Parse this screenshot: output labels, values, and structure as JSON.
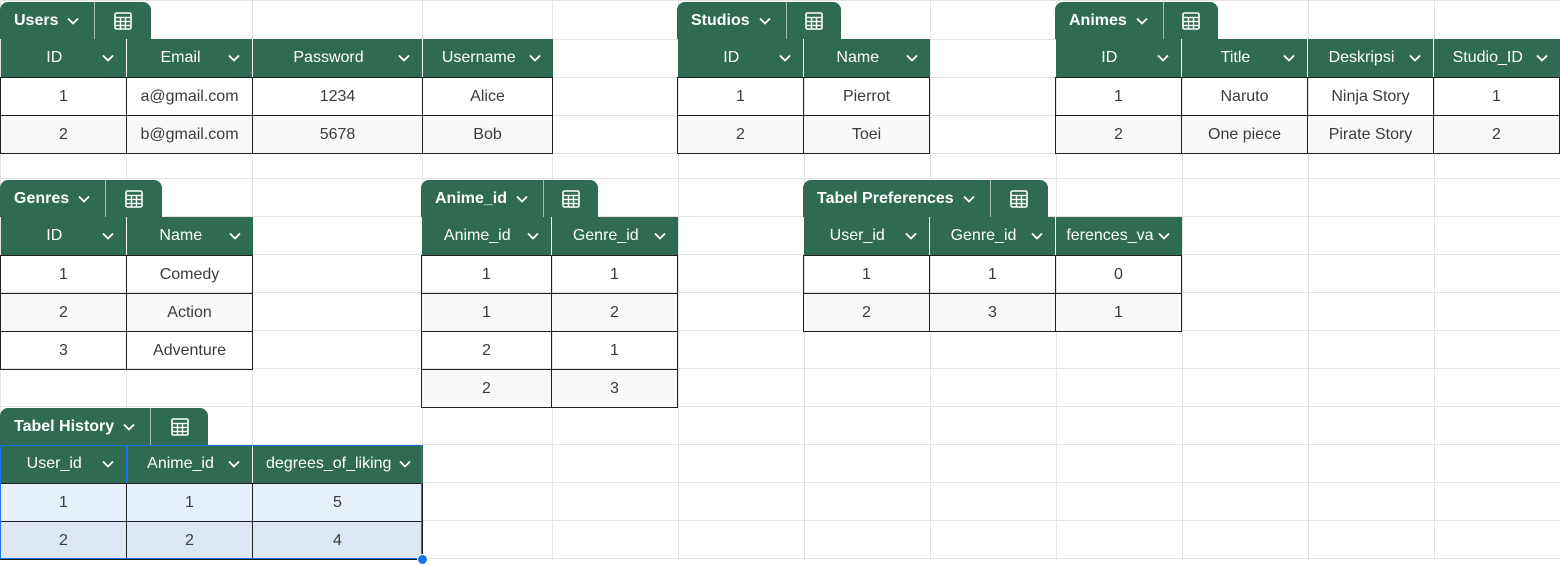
{
  "icons": {
    "dropdown": "chevron-down-icon",
    "table": "table-icon"
  },
  "colors": {
    "header": "#2f6b52",
    "selection": "#1a73e8",
    "text": "#3c3c3c"
  },
  "tables": [
    {
      "key": "users",
      "name": "Users",
      "columns": [
        "ID",
        "Email",
        "Password",
        "Username"
      ],
      "rows": [
        [
          "1",
          "a@gmail.com",
          "1234",
          "Alice"
        ],
        [
          "2",
          "b@gmail.com",
          "5678",
          "Bob"
        ]
      ]
    },
    {
      "key": "studios",
      "name": "Studios",
      "columns": [
        "ID",
        "Name"
      ],
      "rows": [
        [
          "1",
          "Pierrot"
        ],
        [
          "2",
          "Toei"
        ]
      ]
    },
    {
      "key": "animes",
      "name": "Animes",
      "columns": [
        "ID",
        "Title",
        "Deskripsi",
        "Studio_ID"
      ],
      "rows": [
        [
          "1",
          "Naruto",
          "Ninja Story",
          "1"
        ],
        [
          "2",
          "One piece",
          "Pirate Story",
          "2"
        ]
      ]
    },
    {
      "key": "genres",
      "name": "Genres",
      "columns": [
        "ID",
        "Name"
      ],
      "rows": [
        [
          "1",
          "Comedy"
        ],
        [
          "2",
          "Action"
        ],
        [
          "3",
          "Adventure"
        ]
      ]
    },
    {
      "key": "anime_id",
      "name": "Anime_id",
      "columns": [
        "Anime_id",
        "Genre_id"
      ],
      "rows": [
        [
          "1",
          "1"
        ],
        [
          "1",
          "2"
        ],
        [
          "2",
          "1"
        ],
        [
          "2",
          "3"
        ]
      ]
    },
    {
      "key": "preferences",
      "name": "Tabel Preferences",
      "columns": [
        "User_id",
        "Genre_id",
        "eferences_va"
      ],
      "rows": [
        [
          "1",
          "1",
          "0"
        ],
        [
          "2",
          "3",
          "1"
        ]
      ]
    },
    {
      "key": "history",
      "name": "Tabel History",
      "columns": [
        "User_id",
        "Anime_id",
        "degrees_of_liking"
      ],
      "rows": [
        [
          "1",
          "1",
          "5"
        ],
        [
          "2",
          "2",
          "4"
        ]
      ]
    }
  ]
}
